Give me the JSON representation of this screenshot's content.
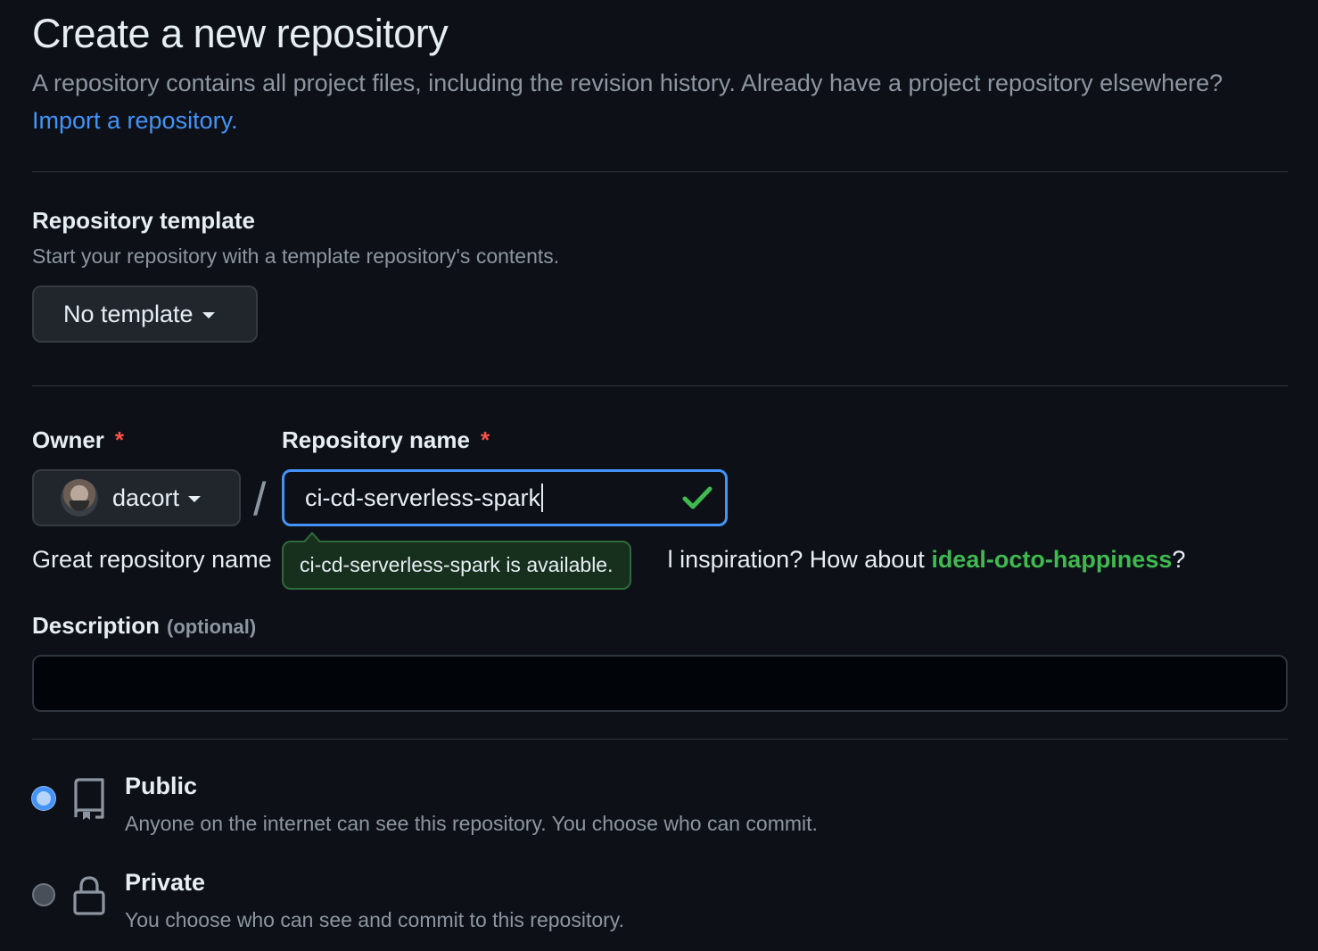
{
  "header": {
    "title": "Create a new repository",
    "subtitle": "A repository contains all project files, including the revision history. Already have a project repository elsewhere?",
    "import_link": "Import a repository."
  },
  "template": {
    "label": "Repository template",
    "note": "Start your repository with a template repository's contents.",
    "selected": "No template"
  },
  "owner": {
    "label": "Owner",
    "required_mark": "*",
    "value": "dacort"
  },
  "separator": "/",
  "repo_name": {
    "label": "Repository name",
    "required_mark": "*",
    "value": "ci-cd-serverless-spark",
    "availability_tooltip": "ci-cd-serverless-spark is available."
  },
  "helper": {
    "prefix": "Great repository name",
    "suffix": "l inspiration? How about",
    "suggestion": "ideal-octo-happiness",
    "end": "?"
  },
  "description": {
    "label": "Description",
    "optional": "(optional)",
    "value": ""
  },
  "visibility": [
    {
      "title": "Public",
      "desc": "Anyone on the internet can see this repository. You choose who can commit.",
      "checked": true,
      "icon": "repo-icon"
    },
    {
      "title": "Private",
      "desc": "You choose who can see and commit to this repository.",
      "checked": false,
      "icon": "lock-icon"
    }
  ],
  "colors": {
    "background": "#0d1117",
    "accent": "#4493f8",
    "success": "#3fb950",
    "danger": "#f85149",
    "muted": "#8d96a0"
  }
}
